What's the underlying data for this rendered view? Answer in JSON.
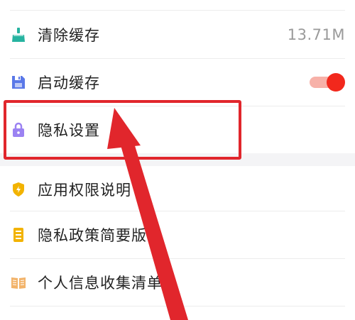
{
  "settings": {
    "items": [
      {
        "label": "清除缓存",
        "value": "13.71M",
        "icon": "broom-icon",
        "icon_color": "#26b3a0"
      },
      {
        "label": "启动缓存",
        "toggle_on": true,
        "icon": "save-icon",
        "icon_color": "#5a78e8"
      },
      {
        "label": "隐私设置",
        "icon": "lock-icon",
        "icon_color": "#9b82f2"
      },
      {
        "label": "应用权限说明",
        "icon": "shield-icon",
        "icon_color": "#f2b300"
      },
      {
        "label": "隐私政策简要版",
        "icon": "document-icon",
        "icon_color": "#f2b300"
      },
      {
        "label": "个人信息收集清单",
        "icon": "book-icon",
        "icon_color": "#f2b36a"
      }
    ]
  },
  "annotation": {
    "highlight_color": "#e1262c",
    "arrow_color": "#e1262c"
  }
}
